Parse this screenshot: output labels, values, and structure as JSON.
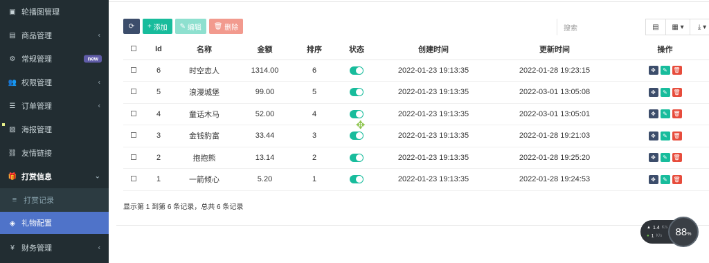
{
  "sidebar": {
    "items": [
      {
        "label": "轮播图管理",
        "icon": "image-icon",
        "chevron": false
      },
      {
        "label": "商品管理",
        "icon": "book-icon",
        "chevron": true
      },
      {
        "label": "常规管理",
        "icon": "cogs-icon",
        "badge": "new"
      },
      {
        "label": "权限管理",
        "icon": "users-icon",
        "chevron": true
      },
      {
        "label": "订单管理",
        "icon": "list-icon",
        "chevron": true
      },
      {
        "label": "海报管理",
        "icon": "picture-icon",
        "chevron": false
      },
      {
        "label": "友情链接",
        "icon": "link-icon",
        "chevron": false
      },
      {
        "label": "打赏信息",
        "icon": "gift-icon",
        "expanded": true
      }
    ],
    "sub_item": {
      "label": "打赏记录",
      "icon": "bars-icon"
    },
    "active_item": {
      "label": "礼物配置",
      "icon": "cube-icon"
    },
    "bottom_item": {
      "label": "财务管理",
      "icon": "yen-icon"
    }
  },
  "toolbar": {
    "refresh_icon": "refresh-icon",
    "add_label": "添加",
    "edit_label": "编辑",
    "delete_label": "删除"
  },
  "search": {
    "placeholder": "搜索"
  },
  "table": {
    "columns": [
      "Id",
      "名称",
      "金额",
      "排序",
      "状态",
      "创建时间",
      "更新时间",
      "操作"
    ],
    "rows": [
      {
        "id": "6",
        "name": "时空恋人",
        "amount": "1314.00",
        "sort": "6",
        "status": true,
        "created": "2022-01-23 19:13:35",
        "updated": "2022-01-28 19:23:15"
      },
      {
        "id": "5",
        "name": "浪漫城堡",
        "amount": "99.00",
        "sort": "5",
        "status": true,
        "created": "2022-01-23 19:13:35",
        "updated": "2022-03-01 13:05:08"
      },
      {
        "id": "4",
        "name": "童话木马",
        "amount": "52.00",
        "sort": "4",
        "status": true,
        "created": "2022-01-23 19:13:35",
        "updated": "2022-03-01 13:05:01"
      },
      {
        "id": "3",
        "name": "金钱豹富",
        "amount": "33.44",
        "sort": "3",
        "status": true,
        "created": "2022-01-23 19:13:35",
        "updated": "2022-01-28 19:21:03"
      },
      {
        "id": "2",
        "name": "抱抱熊",
        "amount": "13.14",
        "sort": "2",
        "status": true,
        "created": "2022-01-23 19:13:35",
        "updated": "2022-01-28 19:25:20"
      },
      {
        "id": "1",
        "name": "一箭倾心",
        "amount": "5.20",
        "sort": "1",
        "status": true,
        "created": "2022-01-23 19:13:35",
        "updated": "2022-01-28 19:24:53"
      }
    ]
  },
  "pagination": {
    "summary": "显示第 1 到第 6 条记录，总共 6 条记录"
  },
  "net_widget": {
    "up_value": "1.4",
    "up_unit": "K/s",
    "down_value": "1",
    "down_unit": "K/s",
    "percent": "88",
    "percent_unit": "%"
  },
  "colors": {
    "sidebar": "#222d32",
    "active": "#4f73c9",
    "success": "#18bc9c",
    "danger": "#e74c3c",
    "primary": "#3c4d6b"
  }
}
